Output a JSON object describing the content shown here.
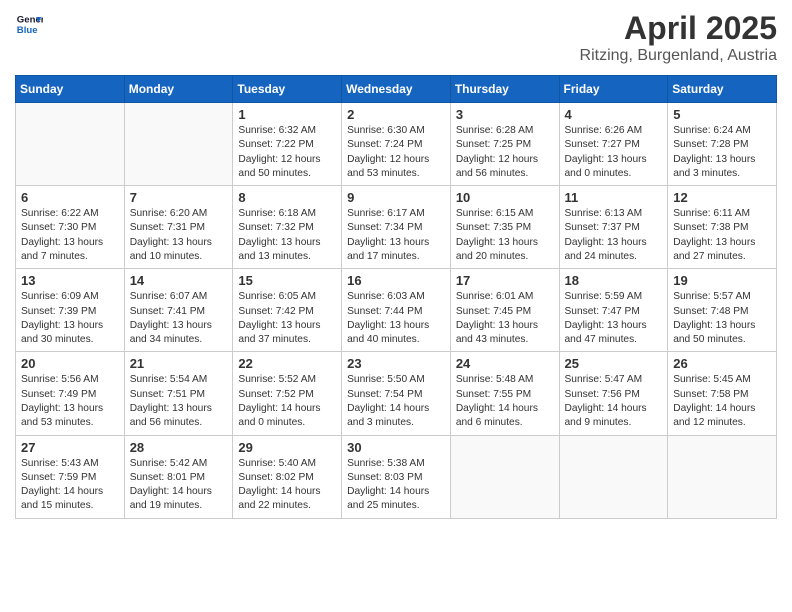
{
  "header": {
    "logo_line1": "General",
    "logo_line2": "Blue",
    "month": "April 2025",
    "location": "Ritzing, Burgenland, Austria"
  },
  "weekdays": [
    "Sunday",
    "Monday",
    "Tuesday",
    "Wednesday",
    "Thursday",
    "Friday",
    "Saturday"
  ],
  "weeks": [
    [
      {
        "day": "",
        "info": ""
      },
      {
        "day": "",
        "info": ""
      },
      {
        "day": "1",
        "info": "Sunrise: 6:32 AM\nSunset: 7:22 PM\nDaylight: 12 hours\nand 50 minutes."
      },
      {
        "day": "2",
        "info": "Sunrise: 6:30 AM\nSunset: 7:24 PM\nDaylight: 12 hours\nand 53 minutes."
      },
      {
        "day": "3",
        "info": "Sunrise: 6:28 AM\nSunset: 7:25 PM\nDaylight: 12 hours\nand 56 minutes."
      },
      {
        "day": "4",
        "info": "Sunrise: 6:26 AM\nSunset: 7:27 PM\nDaylight: 13 hours\nand 0 minutes."
      },
      {
        "day": "5",
        "info": "Sunrise: 6:24 AM\nSunset: 7:28 PM\nDaylight: 13 hours\nand 3 minutes."
      }
    ],
    [
      {
        "day": "6",
        "info": "Sunrise: 6:22 AM\nSunset: 7:30 PM\nDaylight: 13 hours\nand 7 minutes."
      },
      {
        "day": "7",
        "info": "Sunrise: 6:20 AM\nSunset: 7:31 PM\nDaylight: 13 hours\nand 10 minutes."
      },
      {
        "day": "8",
        "info": "Sunrise: 6:18 AM\nSunset: 7:32 PM\nDaylight: 13 hours\nand 13 minutes."
      },
      {
        "day": "9",
        "info": "Sunrise: 6:17 AM\nSunset: 7:34 PM\nDaylight: 13 hours\nand 17 minutes."
      },
      {
        "day": "10",
        "info": "Sunrise: 6:15 AM\nSunset: 7:35 PM\nDaylight: 13 hours\nand 20 minutes."
      },
      {
        "day": "11",
        "info": "Sunrise: 6:13 AM\nSunset: 7:37 PM\nDaylight: 13 hours\nand 24 minutes."
      },
      {
        "day": "12",
        "info": "Sunrise: 6:11 AM\nSunset: 7:38 PM\nDaylight: 13 hours\nand 27 minutes."
      }
    ],
    [
      {
        "day": "13",
        "info": "Sunrise: 6:09 AM\nSunset: 7:39 PM\nDaylight: 13 hours\nand 30 minutes."
      },
      {
        "day": "14",
        "info": "Sunrise: 6:07 AM\nSunset: 7:41 PM\nDaylight: 13 hours\nand 34 minutes."
      },
      {
        "day": "15",
        "info": "Sunrise: 6:05 AM\nSunset: 7:42 PM\nDaylight: 13 hours\nand 37 minutes."
      },
      {
        "day": "16",
        "info": "Sunrise: 6:03 AM\nSunset: 7:44 PM\nDaylight: 13 hours\nand 40 minutes."
      },
      {
        "day": "17",
        "info": "Sunrise: 6:01 AM\nSunset: 7:45 PM\nDaylight: 13 hours\nand 43 minutes."
      },
      {
        "day": "18",
        "info": "Sunrise: 5:59 AM\nSunset: 7:47 PM\nDaylight: 13 hours\nand 47 minutes."
      },
      {
        "day": "19",
        "info": "Sunrise: 5:57 AM\nSunset: 7:48 PM\nDaylight: 13 hours\nand 50 minutes."
      }
    ],
    [
      {
        "day": "20",
        "info": "Sunrise: 5:56 AM\nSunset: 7:49 PM\nDaylight: 13 hours\nand 53 minutes."
      },
      {
        "day": "21",
        "info": "Sunrise: 5:54 AM\nSunset: 7:51 PM\nDaylight: 13 hours\nand 56 minutes."
      },
      {
        "day": "22",
        "info": "Sunrise: 5:52 AM\nSunset: 7:52 PM\nDaylight: 14 hours\nand 0 minutes."
      },
      {
        "day": "23",
        "info": "Sunrise: 5:50 AM\nSunset: 7:54 PM\nDaylight: 14 hours\nand 3 minutes."
      },
      {
        "day": "24",
        "info": "Sunrise: 5:48 AM\nSunset: 7:55 PM\nDaylight: 14 hours\nand 6 minutes."
      },
      {
        "day": "25",
        "info": "Sunrise: 5:47 AM\nSunset: 7:56 PM\nDaylight: 14 hours\nand 9 minutes."
      },
      {
        "day": "26",
        "info": "Sunrise: 5:45 AM\nSunset: 7:58 PM\nDaylight: 14 hours\nand 12 minutes."
      }
    ],
    [
      {
        "day": "27",
        "info": "Sunrise: 5:43 AM\nSunset: 7:59 PM\nDaylight: 14 hours\nand 15 minutes."
      },
      {
        "day": "28",
        "info": "Sunrise: 5:42 AM\nSunset: 8:01 PM\nDaylight: 14 hours\nand 19 minutes."
      },
      {
        "day": "29",
        "info": "Sunrise: 5:40 AM\nSunset: 8:02 PM\nDaylight: 14 hours\nand 22 minutes."
      },
      {
        "day": "30",
        "info": "Sunrise: 5:38 AM\nSunset: 8:03 PM\nDaylight: 14 hours\nand 25 minutes."
      },
      {
        "day": "",
        "info": ""
      },
      {
        "day": "",
        "info": ""
      },
      {
        "day": "",
        "info": ""
      }
    ]
  ]
}
